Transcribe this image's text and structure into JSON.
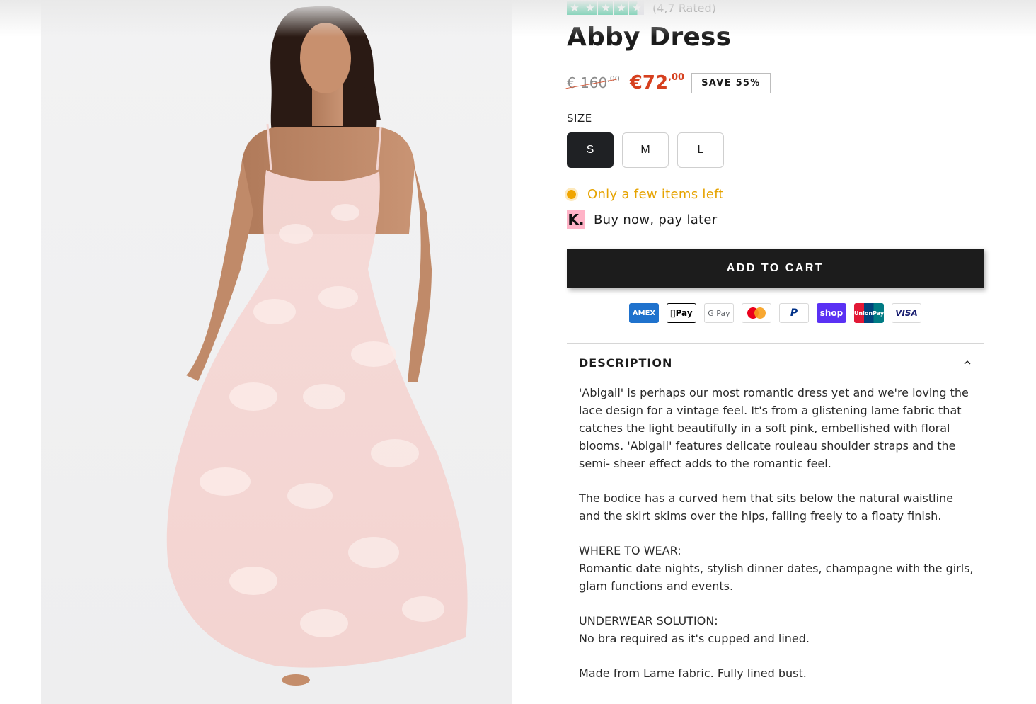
{
  "rating": {
    "text": "(4,7 Rated)",
    "stars": 4.7,
    "star_color": "#00b67a"
  },
  "product": {
    "title": "Abby Dress",
    "old_price": "€ 160",
    "old_price_cents": ",00",
    "new_price": "€72",
    "new_price_cents": ",00",
    "save_badge": "SAVE 55%",
    "price_color": "#d6401f"
  },
  "size": {
    "label": "SIZE",
    "options": [
      "S",
      "M",
      "L"
    ],
    "selected": "S"
  },
  "stock": {
    "text": "Only a few items left",
    "color": "#e6a300"
  },
  "klarna": {
    "logo": "K.",
    "text": "Buy now, pay later"
  },
  "cart": {
    "button_label": "ADD TO CART"
  },
  "payments": {
    "amex": "AMEX",
    "applepay": "Pay",
    "gpay": "G Pay",
    "mastercard": "mastercard",
    "paypal": "P",
    "shop": "shop",
    "unionpay": "UnionPay",
    "visa": "VISA"
  },
  "description": {
    "header": "DESCRIPTION",
    "p1": "'Abigail' is perhaps our most romantic dress yet and we're loving the lace design for a vintage feel. It's from a glistening lame fabric that catches the light beautifully in a soft pink, embellished with floral blooms. 'Abigail' features delicate rouleau shoulder straps and the semi- sheer effect adds to the romantic feel.",
    "p2": "The bodice has a curved hem that sits below the natural waistline and the skirt skims over the hips, falling freely to a floaty finish.",
    "where_heading": "WHERE TO WEAR:",
    "where_text": "Romantic date nights, stylish dinner dates, champagne with the girls, glam functions and events.",
    "underwear_heading": "UNDERWEAR SOLUTION:",
    "underwear_text": "No bra required as it's cupped and lined.",
    "fabric": "Made from Lame fabric. Fully lined bust."
  }
}
